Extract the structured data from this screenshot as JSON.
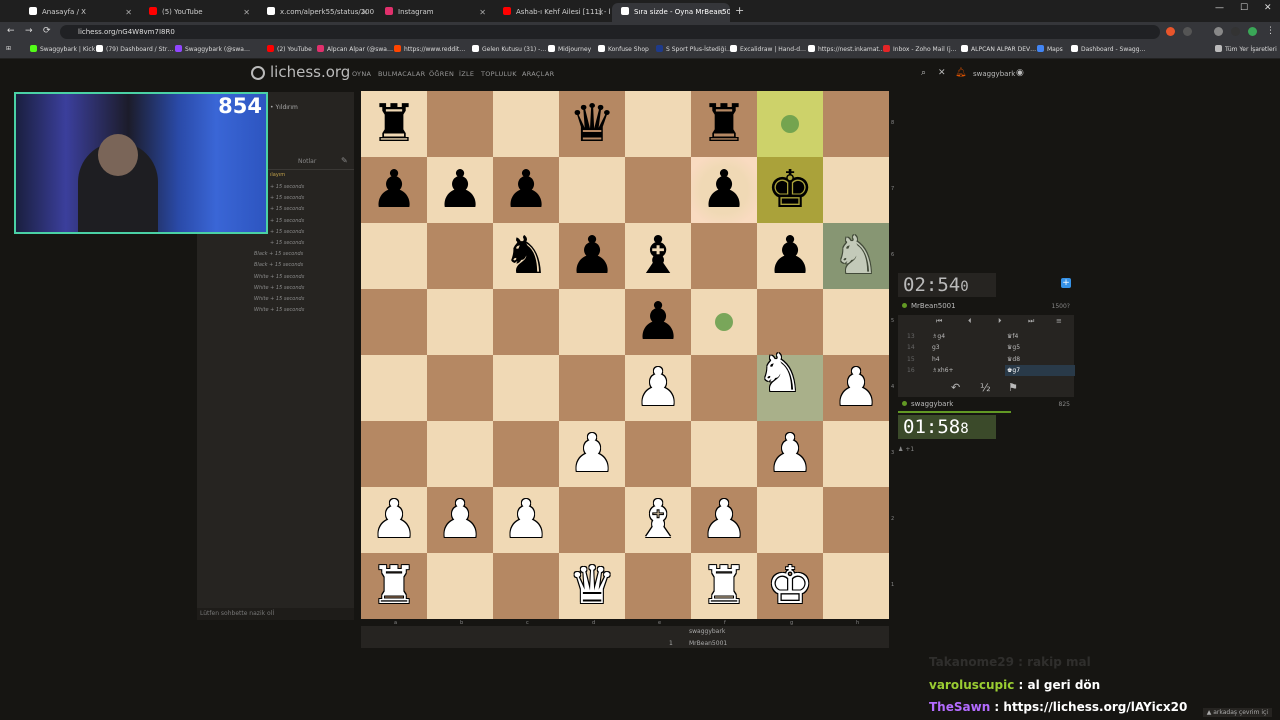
{
  "browser": {
    "tabs": [
      {
        "title": "Anasayfa / X",
        "color": "#ffffff",
        "active": false
      },
      {
        "title": "(5) YouTube",
        "color": "#ff0000",
        "active": false
      },
      {
        "title": "x.com/alperk55/status/200989…",
        "color": "#ffffff",
        "active": false
      },
      {
        "title": "Instagram",
        "color": "#e1306c",
        "active": false
      },
      {
        "title": "Ashab-ı Kehf Ailesi [111] - başl…",
        "color": "#ff0000",
        "active": false
      },
      {
        "title": "Sıra sizde - Oyna MrBean5001",
        "color": "#ffffff",
        "active": true
      }
    ],
    "url": "lichess.org/nG4W8vm7I8R0",
    "bookmarks": [
      "Swaggybark | Kick",
      "(79) Dashboard / Str…",
      "Swaggybark (@swa…",
      "(2) YouTube",
      "Alpcan Alpar (@swa…",
      "https://www.reddit…",
      "Gelen Kutusu (31) -…",
      "Midjourney",
      "Konfuse Shop",
      "S Sport Plus-İstediği…",
      "Excalidraw | Hand-d…",
      "https://nest.inkamat…",
      "Inbox - Zoho Mail (j…",
      "ALPCAN ALPAR DEV…",
      "Maps",
      "Dashboard - Swagg…"
    ],
    "all_bookmarks": "Tüm Yer İşaretleri"
  },
  "site": {
    "logo": "lichess.org",
    "menu": [
      "OYNA",
      "BULMACALAR",
      "ÖĞREN",
      "İZLE",
      "TOPLULUK",
      "ARAÇLAR"
    ],
    "username": "swaggybark"
  },
  "webcam": {
    "rating": "854"
  },
  "left": {
    "header": "• Yıldırım",
    "notes": "Notlar",
    "log_first": "ılayım",
    "log": [
      "+ 15 seconds",
      "+ 15 seconds",
      "+ 15 seconds",
      "+ 15 seconds",
      "+ 15 seconds",
      "+ 15 seconds",
      "Black + 15 seconds",
      "Black + 15 seconds",
      "White + 15 seconds",
      "White + 15 seconds",
      "White + 15 seconds",
      "White + 15 seconds"
    ],
    "chat_placeholder": "Lütfen sohbette nazik olİ"
  },
  "board": {
    "ranks": [
      [
        "r",
        "",
        "",
        "q",
        "",
        "r",
        "",
        ""
      ],
      [
        "p",
        "p",
        "p",
        "",
        "",
        "p",
        "k",
        ""
      ],
      [
        "",
        "",
        "n",
        "p",
        "b",
        "",
        "p",
        "N"
      ],
      [
        "",
        "",
        "",
        "",
        "p",
        "",
        "",
        ""
      ],
      [
        "",
        "",
        "",
        "",
        "P",
        "",
        "N",
        "P"
      ],
      [
        "",
        "",
        "",
        "P",
        "",
        "",
        "P",
        ""
      ],
      [
        "P",
        "P",
        "P",
        "",
        "B",
        "P",
        "",
        ""
      ],
      [
        "R",
        "",
        "",
        "Q",
        "",
        "R",
        "K",
        ""
      ]
    ],
    "files": [
      "a",
      "b",
      "c",
      "d",
      "e",
      "f",
      "g",
      "h"
    ],
    "rank_labels": [
      "8",
      "7",
      "6",
      "5",
      "4",
      "3",
      "2",
      "1"
    ]
  },
  "game": {
    "opponent": {
      "name": "MrBean5001",
      "rating": "1500?",
      "clock": "02:54",
      "tenth": "0"
    },
    "me": {
      "name": "swaggybark",
      "rating": "825",
      "clock": "01:58",
      "tenth": "8"
    },
    "moves": [
      {
        "n": "13",
        "w": "♗g4",
        "b": "♛f4"
      },
      {
        "n": "14",
        "w": "g3",
        "b": "♛g5"
      },
      {
        "n": "15",
        "w": "h4",
        "b": "♛d8"
      },
      {
        "n": "16",
        "w": "♗xh6+",
        "b": "♚g7"
      }
    ],
    "draw": "½",
    "spectators": "+1"
  },
  "below": {
    "white": "swaggybark",
    "row2_n": "1",
    "black": "MrBean5001"
  },
  "stream_chat": [
    {
      "user": "Takanome29",
      "msg": "rakip mal",
      "ucolor": "#3d3d3d",
      "mcolor": "#3d3d3d"
    },
    {
      "user": "varoluscupic",
      "msg": "al geri dön",
      "ucolor": "#9acd32",
      "mcolor": "#ffffff"
    },
    {
      "user": "TheSawn",
      "msg": "https://lichess.org/lAYicx20",
      "ucolor": "#8a2be2",
      "mcolor": "#ffffff"
    }
  ],
  "friends": "arkadaş çevrim içi"
}
